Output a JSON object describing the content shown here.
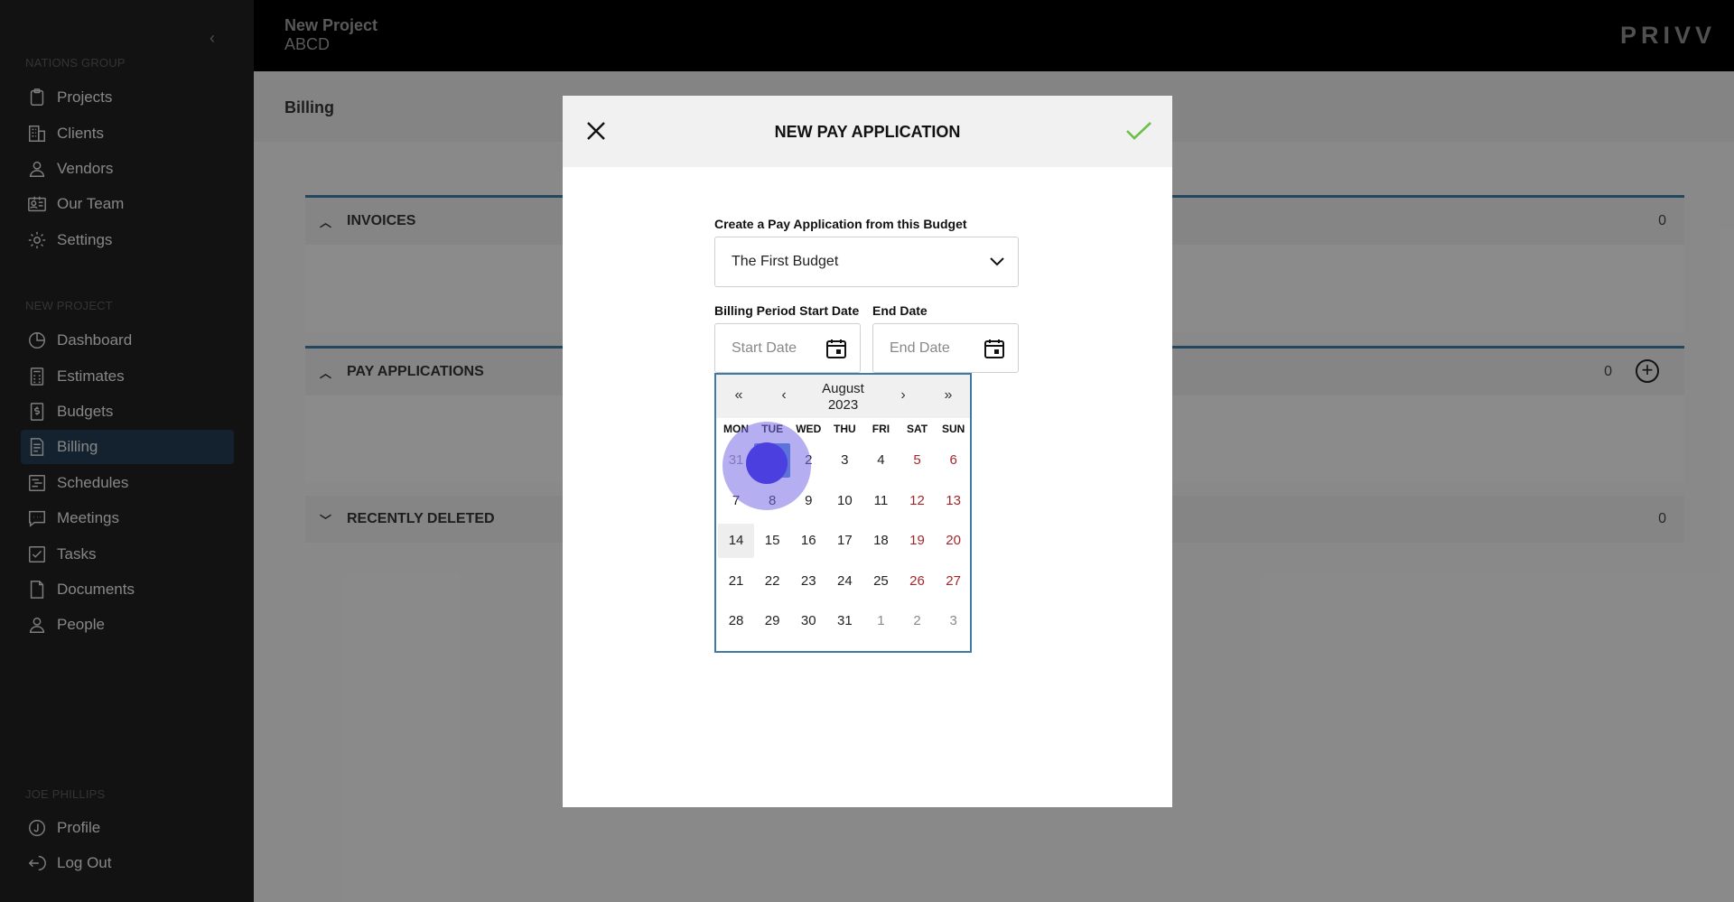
{
  "sidebar": {
    "collapse_icon": "chevron-left-icon",
    "group_label": "NATIONS GROUP",
    "group_items": [
      {
        "label": "Projects",
        "icon": "clipboard-icon"
      },
      {
        "label": "Clients",
        "icon": "building-icon"
      },
      {
        "label": "Vendors",
        "icon": "person-icon"
      },
      {
        "label": "Our Team",
        "icon": "id-card-icon"
      },
      {
        "label": "Settings",
        "icon": "gear-icon"
      }
    ],
    "project_label": "NEW PROJECT",
    "project_items": [
      {
        "label": "Dashboard",
        "icon": "pie-chart-icon"
      },
      {
        "label": "Estimates",
        "icon": "calculator-icon"
      },
      {
        "label": "Budgets",
        "icon": "dollar-doc-icon"
      },
      {
        "label": "Billing",
        "icon": "invoice-icon",
        "active": true
      },
      {
        "label": "Schedules",
        "icon": "gantt-icon"
      },
      {
        "label": "Meetings",
        "icon": "chat-icon"
      },
      {
        "label": "Tasks",
        "icon": "checkbox-icon"
      },
      {
        "label": "Documents",
        "icon": "document-icon"
      },
      {
        "label": "People",
        "icon": "person-icon"
      }
    ],
    "user_label": "JOE PHILLIPS",
    "user_items": [
      {
        "label": "Profile",
        "icon": "profile-icon"
      },
      {
        "label": "Log Out",
        "icon": "logout-icon"
      }
    ]
  },
  "header": {
    "project_name": "New Project",
    "project_code": "ABCD",
    "logo": "PRIVV"
  },
  "page": {
    "title": "Billing",
    "panels": [
      {
        "label": "INVOICES",
        "count": "0",
        "expanded": true
      },
      {
        "label": "PAY APPLICATIONS",
        "count": "0",
        "expanded": true,
        "has_add": true
      },
      {
        "label": "RECENTLY DELETED",
        "count": "0",
        "expanded": false
      }
    ]
  },
  "modal": {
    "title": "NEW PAY APPLICATION",
    "close_icon": "close-icon",
    "confirm_icon": "check-icon",
    "confirm_color": "#6cc04a",
    "budget_label": "Create a Pay Application from this Budget",
    "budget_value": "The First Budget",
    "start_label": "Billing Period Start Date",
    "start_placeholder": "Start Date",
    "end_label": "End Date",
    "end_placeholder": "End Date"
  },
  "calendar": {
    "month": "August",
    "year": "2023",
    "nav": {
      "prev_year": "«",
      "prev_month": "‹",
      "next_month": "›",
      "next_year": "»"
    },
    "weekdays": [
      "MON",
      "TUE",
      "WED",
      "THU",
      "FRI",
      "SAT",
      "SUN"
    ],
    "weeks": [
      [
        "31",
        "1",
        "2",
        "3",
        "4",
        "5",
        "6"
      ],
      [
        "7",
        "8",
        "9",
        "10",
        "11",
        "12",
        "13"
      ],
      [
        "14",
        "15",
        "16",
        "17",
        "18",
        "19",
        "20"
      ],
      [
        "21",
        "22",
        "23",
        "24",
        "25",
        "26",
        "27"
      ],
      [
        "28",
        "29",
        "30",
        "31",
        "1",
        "2",
        "3"
      ]
    ],
    "today": "14",
    "hovered": "1",
    "weekend_color": "#a4262c",
    "accent_color": "#3e7aa5"
  }
}
